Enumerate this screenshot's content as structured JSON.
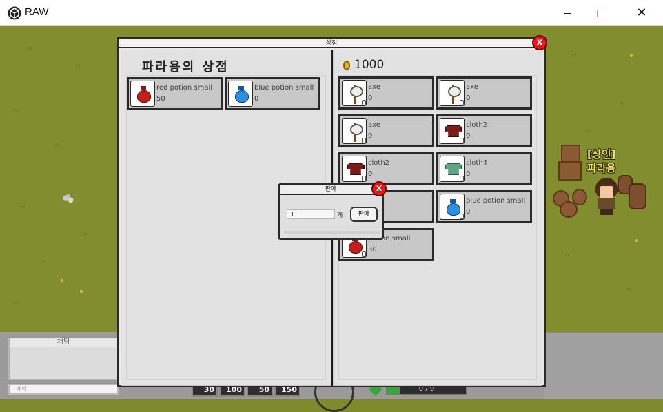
{
  "window": {
    "title": "RAW",
    "min_icon": "minimize-icon",
    "max_icon": "maximize-icon",
    "close_icon": "close-icon",
    "close_glyph": "✕"
  },
  "chat": {
    "tab_label": "채팅",
    "input_text": "채팅"
  },
  "hotbar": [
    {
      "label": "30"
    },
    {
      "label": "100"
    },
    {
      "label": "50"
    },
    {
      "label": "150"
    }
  ],
  "status": {
    "hp_text": "0 / 0"
  },
  "npc": {
    "tag_line1": "[상인]",
    "tag_line2": "파라용"
  },
  "shop": {
    "title": "상점",
    "close_glyph": "x",
    "shop_name": "파라용의 상점",
    "gold": "1000",
    "sell_items": [
      {
        "name": "red potion small",
        "count": "50",
        "icon": "red-potion-icon"
      },
      {
        "name": "blue potion small",
        "count": "0",
        "icon": "blue-potion-icon"
      }
    ],
    "inventory": [
      {
        "name": "axe",
        "count": "0",
        "icon": "axe-icon"
      },
      {
        "name": "axe",
        "count": "0",
        "icon": "axe-icon"
      },
      {
        "name": "axe",
        "count": "0",
        "icon": "axe-icon"
      },
      {
        "name": "cloth2",
        "count": "0",
        "icon": "cloth-icon"
      },
      {
        "name": "cloth2",
        "count": "0",
        "icon": "cloth-icon"
      },
      {
        "name": "cloth4",
        "count": "0",
        "icon": "cloth-icon"
      },
      {
        "name": "",
        "count": "",
        "icon": ""
      },
      {
        "name": "blue potion small",
        "count": "0",
        "icon": "blue-potion-icon"
      },
      {
        "name": "potion small",
        "count": "30",
        "icon": "red-potion-icon"
      }
    ]
  },
  "sell_dialog": {
    "title": "판매",
    "close_glyph": "x",
    "quantity": "1",
    "unit": "개",
    "button": "판매"
  },
  "colors": {
    "grass": "#818d2e",
    "close_red": "#e21b1b",
    "npc_tag": "#f4e24a"
  }
}
